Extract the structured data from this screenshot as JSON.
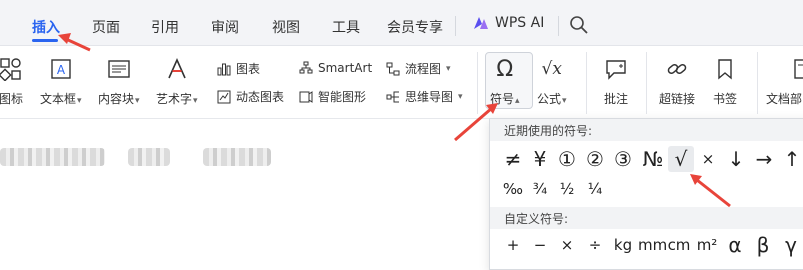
{
  "tabs": [
    {
      "label": "插入",
      "active": true
    },
    {
      "label": "页面"
    },
    {
      "label": "引用"
    },
    {
      "label": "审阅"
    },
    {
      "label": "视图"
    },
    {
      "label": "工具"
    },
    {
      "label": "会员专享"
    }
  ],
  "wps_ai_label": "WPS AI",
  "ribbon": {
    "icon_label": "图标",
    "textbox_label": "文本框",
    "contentblock_label": "内容块",
    "wordart_label": "艺术字",
    "chart_label": "图表",
    "dynamic_chart_label": "动态图表",
    "smartart_label": "SmartArt",
    "smart_shape_label": "智能图形",
    "flowchart_label": "流程图",
    "mindmap_label": "思维导图",
    "symbol_label": "符号",
    "formula_label": "公式",
    "comment_label": "批注",
    "hyperlink_label": "超链接",
    "bookmark_label": "书签",
    "header_label": "文档部"
  },
  "symbol_panel": {
    "recent_title": "近期使用的符号:",
    "recent_row1": [
      "≠",
      "¥",
      "①",
      "②",
      "③",
      "№",
      "√",
      "×",
      "↓",
      "→",
      "↑"
    ],
    "recent_row2": [
      "‰",
      "¾",
      "½",
      "¼"
    ],
    "custom_title": "自定义符号:",
    "custom_row": [
      "+",
      "−",
      "×",
      "÷",
      "kg",
      "mm",
      "cm",
      "m²",
      "α",
      "β",
      "γ"
    ],
    "highlighted_symbol": "√"
  },
  "colors": {
    "accent": "#2a64f0",
    "annotation_arrow": "#e8443a"
  }
}
